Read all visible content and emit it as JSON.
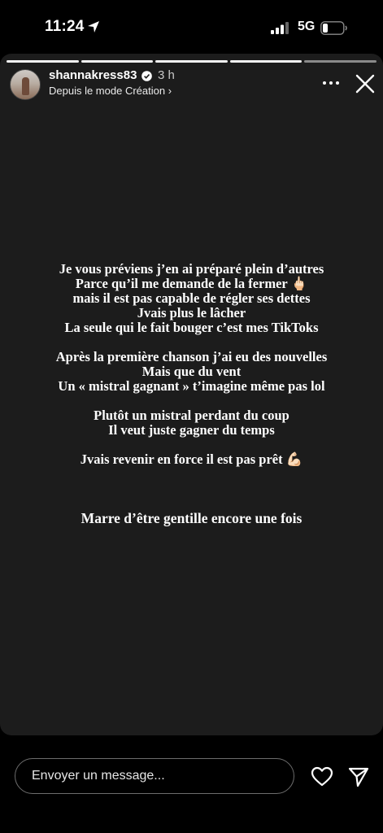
{
  "status_bar": {
    "time": "11:24",
    "network": "5G",
    "icons": [
      "location-arrow-icon",
      "signal-icon",
      "battery-icon"
    ]
  },
  "story": {
    "progress_segments": 5,
    "active_segment": 5,
    "username": "shannakress83",
    "verified": true,
    "time_ago": "3 h",
    "subline": "Depuis le mode Création ›",
    "blocks": [
      [
        "Je vous préviens j’en ai préparé plein d’autres",
        "Parce qu’il me demande de la fermer 🖕🏻",
        "mais il est pas capable de régler ses dettes",
        "Jvais plus le lâcher",
        "La seule qui le fait bouger c’est mes TikToks"
      ],
      [
        "Après la première chanson j’ai eu des nouvelles",
        "Mais que du vent",
        "Un « mistral gagnant » t’imagine même pas lol"
      ],
      [
        "Plutôt un mistral perdant du coup",
        "Il veut juste gagner du temps"
      ],
      [
        "Jvais revenir en force il est pas prêt 💪🏻"
      ]
    ],
    "final_line": "Marre d’être gentille encore une fois"
  },
  "composer": {
    "placeholder": "Envoyer un message..."
  },
  "colors": {
    "background": "#000000",
    "card": "#1c1c1c",
    "verified_badge": "#ffffff"
  }
}
